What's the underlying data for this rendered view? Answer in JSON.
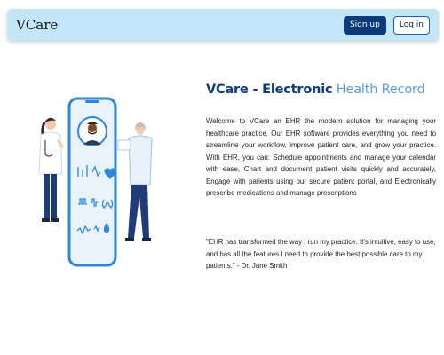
{
  "navbar": {
    "brand": "VCare",
    "signup_label": "Sign up",
    "login_label": "Log in"
  },
  "hero": {
    "headline_part1": "VCare - Electronic",
    "headline_part2": " Health Record",
    "intro": "Welcome to VCare an EHR the modern solution for managing your healthcare practice. Our EHR software provides everything you need to streamline your workflow, improve patient care, and grow your practice. With EHR, you can: Schedule appointments and manage your calendar with ease, Chart and document patient visits quickly and accurately, Engage with patients using our secure patient portal, and Electronically prescribe medications and manage prescriptions",
    "testimonial": "\"EHR has transformed the way I run my practice. It's intuitive, easy to use, and has all the features I need to provide the best possible care to my patients.\" - Dr. Jane Smith"
  },
  "colors": {
    "navbar_bg": "#c3e6f8",
    "primary": "#0b3c7a",
    "accent": "#5a9fd6"
  },
  "icons": [
    "heart-icon",
    "heartbeat-icon",
    "lungs-icon",
    "water-drop-icon",
    "doctor-avatar-icon"
  ]
}
